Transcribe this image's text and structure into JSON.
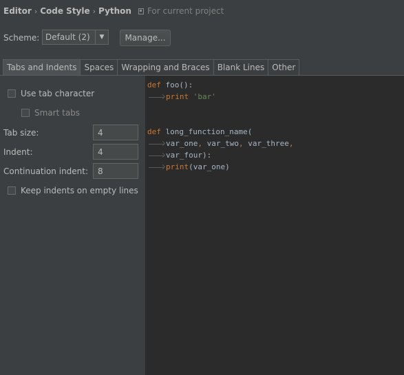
{
  "breadcrumb": {
    "items": [
      "Editor",
      "Code Style",
      "Python"
    ],
    "note": "For current project",
    "note_icon": "project-icon"
  },
  "scheme": {
    "label": "Scheme:",
    "value": "Default (2)",
    "manage_label": "Manage..."
  },
  "tabs": [
    "Tabs and Indents",
    "Spaces",
    "Wrapping and Braces",
    "Blank Lines",
    "Other"
  ],
  "active_tab": "Tabs and Indents",
  "options": {
    "use_tab_character": {
      "label": "Use tab character",
      "checked": false
    },
    "smart_tabs": {
      "label": "Smart tabs",
      "checked": false,
      "enabled": false
    },
    "tab_size": {
      "label": "Tab size:",
      "value": "4"
    },
    "indent": {
      "label": "Indent:",
      "value": "4"
    },
    "continuation_indent": {
      "label": "Continuation indent:",
      "value": "8"
    },
    "keep_indents": {
      "label": "Keep indents on empty lines",
      "checked": false
    }
  },
  "code": {
    "l1_kw": "def",
    "l1_rest": " foo():",
    "l2_kw": "print",
    "l2_str": "'bar'",
    "l4_kw": "def",
    "l4_rest": " long_function_name(",
    "l5_a": "var_one",
    "l5_b": "var_two",
    "l5_c": "var_three",
    "l6_a": "var_four",
    "l6_b": "):",
    "l7_kw": "print",
    "l7_rest": "(var_one)"
  },
  "colors": {
    "keyword": "#cc7832",
    "string": "#6a8759",
    "identifier": "#a9b7c6",
    "editor_bg": "#2b2b2b",
    "panel_bg": "#3c3f41"
  }
}
